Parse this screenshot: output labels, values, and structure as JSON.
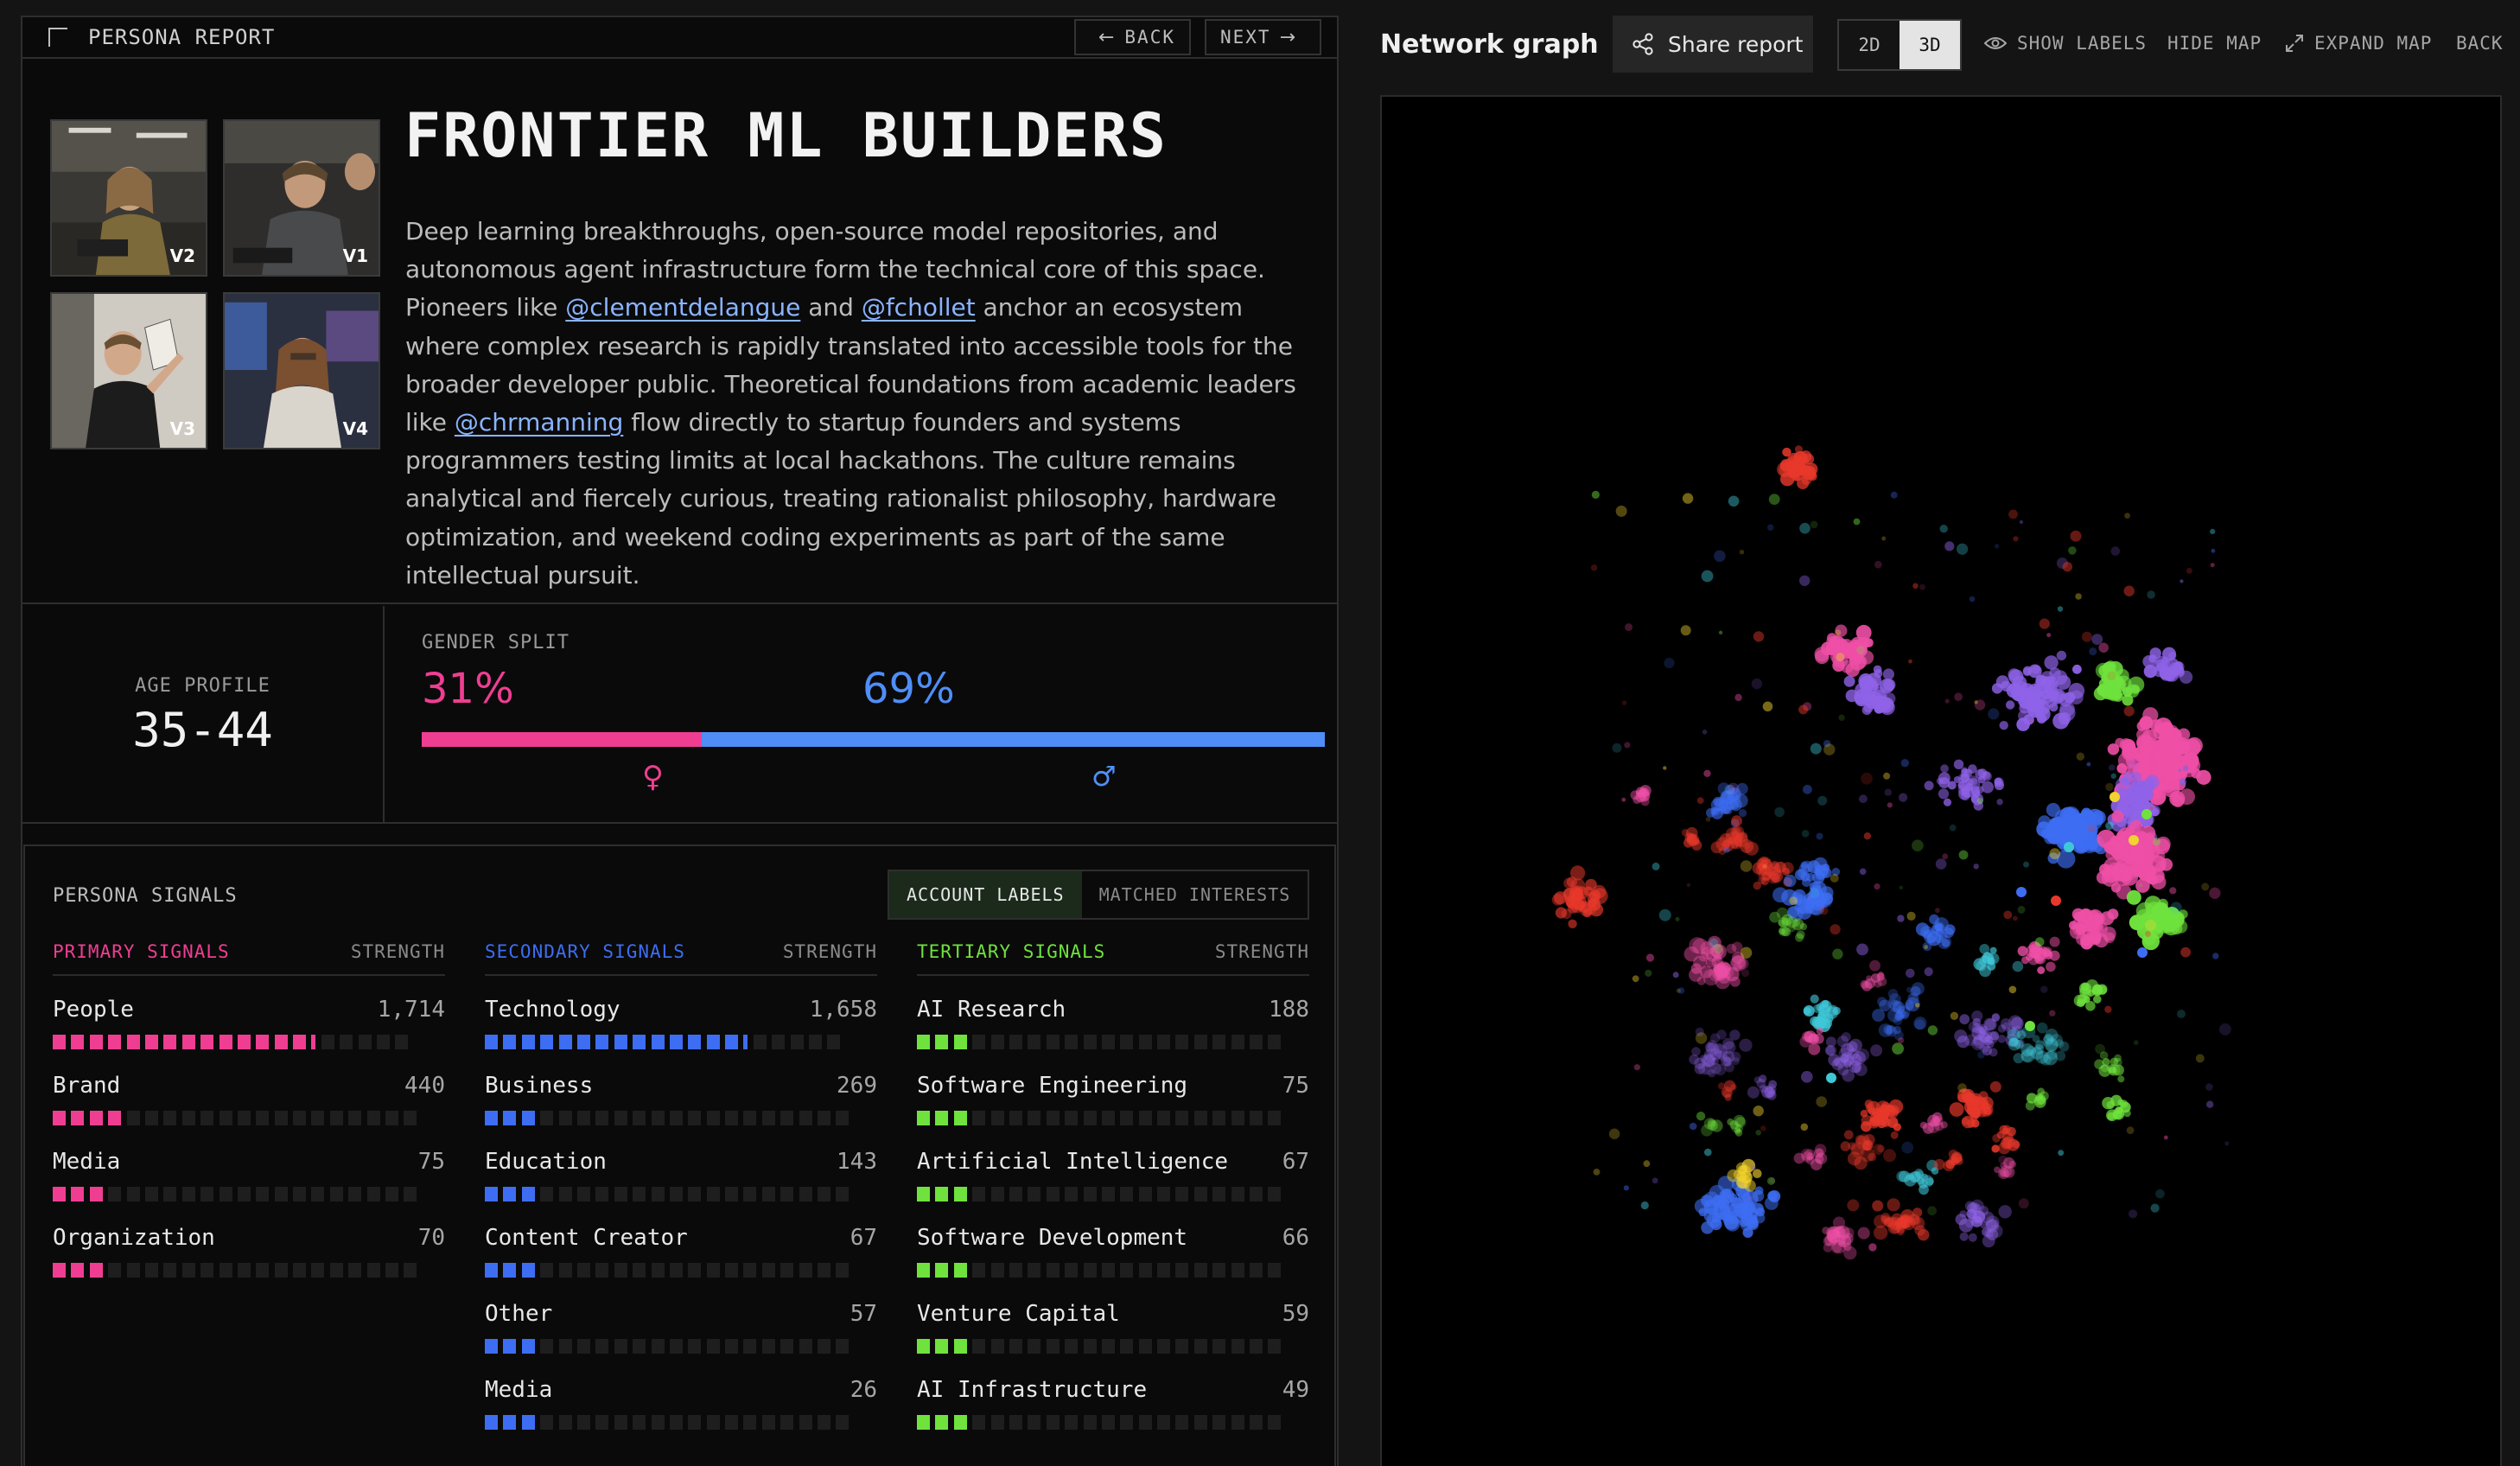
{
  "report": {
    "header_title": "PERSONA REPORT",
    "back_label": "BACK",
    "next_label": "NEXT"
  },
  "persona": {
    "title": "FRONTIER ML BUILDERS",
    "thumbnails": [
      {
        "label": "V2"
      },
      {
        "label": "V1"
      },
      {
        "label": "V3"
      },
      {
        "label": "V4"
      }
    ],
    "description": {
      "part1": "Deep learning breakthroughs, open-source model repositories, and autonomous agent infrastructure form the technical core of this space. Pioneers like ",
      "mention1": "@clementdelangue",
      "part2": " and ",
      "mention2": "@fchollet",
      "part3": " anchor an ecosystem where complex research is rapidly translated into accessible tools for the broader developer public. Theoretical foundations from academic leaders like ",
      "mention3": "@chrmanning",
      "part4": " flow directly to startup founders and systems programmers testing limits at local hackathons. The culture remains analytical and fiercely curious, treating rationalist philosophy, hardware optimization, and weekend coding experiments as part of the same intellectual pursuit."
    }
  },
  "demographics": {
    "age_label": "AGE PROFILE",
    "age_value": "35-44",
    "gender_label": "GENDER SPLIT",
    "female_pct_text": "31%",
    "male_pct_text": "69%",
    "female_fraction": 0.31,
    "female_symbol": "♀",
    "male_symbol": "♂",
    "female_color": "#ef3e92",
    "male_color": "#4f8ef7"
  },
  "signals": {
    "title": "PERSONA SIGNALS",
    "toggle": {
      "account_labels": "ACCOUNT LABELS",
      "matched_interests": "MATCHED INTERESTS",
      "active": "account_labels"
    },
    "strength_label": "STRENGTH",
    "columns": [
      {
        "key": "primary",
        "title": "PRIMARY SIGNALS",
        "color": "#ef3e92",
        "items": [
          {
            "name": "People",
            "count": "1,714",
            "level": 14.6
          },
          {
            "name": "Brand",
            "count": "440",
            "level": 4
          },
          {
            "name": "Media",
            "count": "75",
            "level": 3
          },
          {
            "name": "Organization",
            "count": "70",
            "level": 3
          }
        ]
      },
      {
        "key": "secondary",
        "title": "SECONDARY SIGNALS",
        "color": "#3d6df2",
        "items": [
          {
            "name": "Technology",
            "count": "1,658",
            "level": 14.3
          },
          {
            "name": "Business",
            "count": "269",
            "level": 3
          },
          {
            "name": "Education",
            "count": "143",
            "level": 3
          },
          {
            "name": "Content Creator",
            "count": "67",
            "level": 3
          },
          {
            "name": "Other",
            "count": "57",
            "level": 3
          },
          {
            "name": "Media",
            "count": "26",
            "level": 3
          }
        ]
      },
      {
        "key": "tertiary",
        "title": "TERTIARY SIGNALS",
        "color": "#6fe23d",
        "items": [
          {
            "name": "AI Research",
            "count": "188",
            "level": 3
          },
          {
            "name": "Software Engineering",
            "count": "75",
            "level": 3
          },
          {
            "name": "Artificial Intelligence",
            "count": "67",
            "level": 3
          },
          {
            "name": "Software Development",
            "count": "66",
            "level": 3
          },
          {
            "name": "Venture Capital",
            "count": "59",
            "level": 3
          },
          {
            "name": "AI Infrastructure",
            "count": "49",
            "level": 3
          }
        ]
      }
    ],
    "segments_total": 20
  },
  "graph": {
    "title": "Network graph",
    "share_label": "Share report",
    "dim_2d": "2D",
    "dim_3d": "3D",
    "dim_active": "3D",
    "show_labels": "SHOW LABELS",
    "hide_map": "HIDE MAP",
    "expand_map": "EXPAND MAP",
    "back": "BACK",
    "cluster_colors": [
      "#ef4fa6",
      "#3d6df2",
      "#6fe23d",
      "#8f63e8",
      "#e8382b",
      "#3fc7d8",
      "#f2d22e"
    ]
  }
}
